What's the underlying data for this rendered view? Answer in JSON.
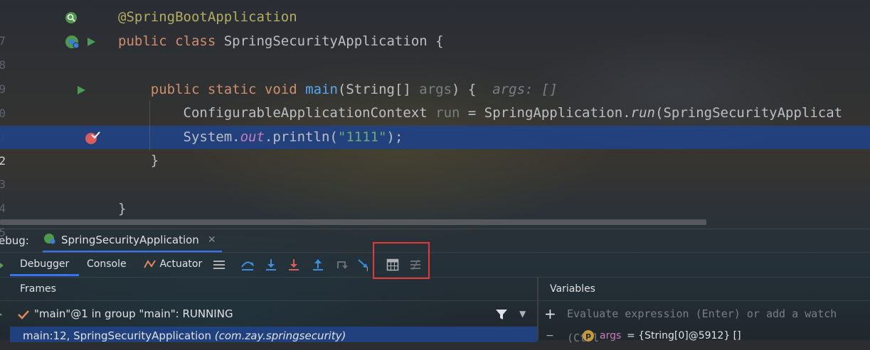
{
  "editor": {
    "lines": [
      {
        "num": "7",
        "tokens": [
          {
            "t": "@SpringBootApplication",
            "c": "ann"
          }
        ]
      },
      {
        "num": "8",
        "tokens": [
          {
            "t": "public ",
            "c": "kw"
          },
          {
            "t": "class ",
            "c": "kw"
          },
          {
            "t": "SpringSecurityApplication {",
            "c": ""
          }
        ]
      },
      {
        "num": "9",
        "tokens": []
      },
      {
        "num": "0",
        "tokens": [
          {
            "t": "    public ",
            "c": "kw"
          },
          {
            "t": "static ",
            "c": "kw"
          },
          {
            "t": "void ",
            "c": "kw"
          },
          {
            "t": "main",
            "c": "fn"
          },
          {
            "t": "(String[] ",
            "c": ""
          },
          {
            "t": "args",
            "c": "param"
          },
          {
            "t": ") {",
            "c": ""
          }
        ]
      },
      {
        "num": "1",
        "tokens": [
          {
            "t": "        ConfigurableApplicationContext ",
            "c": ""
          },
          {
            "t": "run",
            "c": "param"
          },
          {
            "t": " = SpringApplication.",
            "c": ""
          },
          {
            "t": "run",
            "c": "ital"
          },
          {
            "t": "(SpringSecurityApplicat",
            "c": ""
          }
        ]
      },
      {
        "num": "2",
        "tokens": [
          {
            "t": "        System.",
            "c": ""
          },
          {
            "t": "out",
            "c": "field"
          },
          {
            "t": ".println(",
            "c": ""
          },
          {
            "t": "\"1111\"",
            "c": "str"
          },
          {
            "t": ");",
            "c": ""
          }
        ]
      },
      {
        "num": "3",
        "tokens": [
          {
            "t": "    }",
            "c": ""
          }
        ]
      },
      {
        "num": "4",
        "tokens": []
      },
      {
        "num": "5",
        "tokens": [
          {
            "t": "}",
            "c": ""
          }
        ]
      }
    ],
    "inlay_hint": "args: []"
  },
  "debug": {
    "label": "ebug:",
    "session_tab": "SpringSecurityApplication",
    "tabs": [
      "Debugger",
      "Console",
      "Actuator"
    ],
    "frames_title": "Frames",
    "variables_title": "Variables",
    "thread": "\"main\"@1 in group \"main\": RUNNING",
    "frame": "main:12, SpringSecurityApplication",
    "frame_pkg": "(com.zay.springsecurity)",
    "watch_placeholder": "Evaluate expression (Enter) or add a watch (Ctrl",
    "var_name": "args",
    "var_value": "= {String[0]@5912} []"
  },
  "colors": {
    "accent": "#3574f0",
    "highlight_box": "#e5383b",
    "current_line": "#214283"
  }
}
